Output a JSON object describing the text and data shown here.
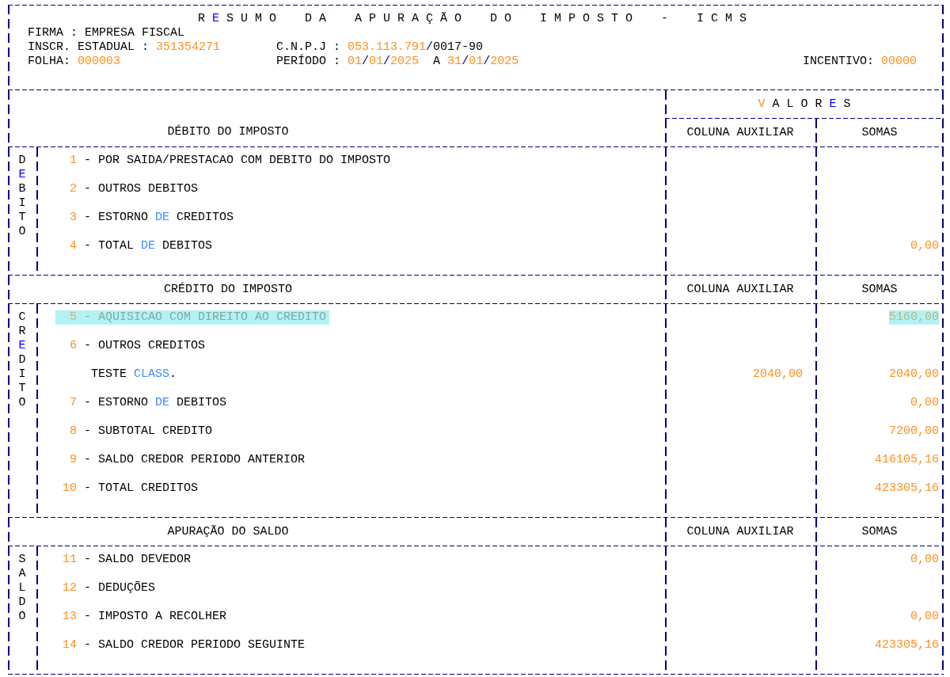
{
  "header": {
    "title": [
      {
        "text": "R"
      },
      {
        "text": "E",
        "color": "#0000ff"
      },
      {
        "text": "SUMO DA APURAÇÃO DO IMPOSTO - ICMS"
      }
    ],
    "firma": {
      "label": "FIRMA :",
      "value": "EMPRESA FISCAL"
    },
    "inscricao": {
      "label": "INSCR. ESTADUAL :",
      "value": "351354271"
    },
    "cnpj": {
      "label": "C.N.P.J :",
      "root": "053.113.791",
      "branch": "/0017-90"
    },
    "folha": {
      "label": "FOLHA:",
      "value": "000003"
    },
    "periodo": {
      "label": "PERÍODO :",
      "start": "01/01/2025",
      "joiner": "A",
      "end": "31/01/2025"
    },
    "incentivo": {
      "label": "INCENTIVO:",
      "value": "00000"
    }
  },
  "values_heading": [
    {
      "text": "V",
      "color": "#ff9020"
    },
    {
      "text": "ALOR"
    },
    {
      "text": "E",
      "color": "#0000ff"
    },
    {
      "text": "S"
    }
  ],
  "sections": [
    {
      "heading": "DÉBITO DO IMPOSTO",
      "aux_heading": "COLUNA AUXILIAR",
      "sum_heading": "SOMAS",
      "side_letters": [
        {
          "char": "D"
        },
        {
          "char": "E",
          "color": "#0000ff"
        },
        {
          "char": "B"
        },
        {
          "char": "I"
        },
        {
          "char": "T"
        },
        {
          "char": "O"
        }
      ],
      "items": [
        {
          "kind": "line",
          "number": "1",
          "label": [
            {
              "text": "- POR SAIDA/PRESTACAO COM DEBITO DO IMPOSTO",
              "kind": "plain"
            }
          ],
          "selected": false
        },
        {
          "kind": "line",
          "number": "2",
          "label": [
            {
              "text": "- OUTROS DEBITOS",
              "kind": "plain"
            }
          ],
          "selected": false
        },
        {
          "kind": "line",
          "number": "3",
          "label": [
            {
              "text": "- ESTORNO ",
              "kind": "plain"
            },
            {
              "text": "DE",
              "kind": "keyword"
            },
            {
              "text": " CREDITOS",
              "kind": "plain"
            }
          ],
          "selected": false
        },
        {
          "kind": "line",
          "number": "4",
          "label": [
            {
              "text": "- TOTAL ",
              "kind": "plain"
            },
            {
              "text": "DE",
              "kind": "keyword"
            },
            {
              "text": " DEBITOS",
              "kind": "plain"
            }
          ],
          "sum": "0,00",
          "selected": false
        }
      ]
    },
    {
      "heading": "CRÉDITO DO IMPOSTO",
      "aux_heading": "COLUNA AUXILIAR",
      "sum_heading": "SOMAS",
      "side_letters": [
        {
          "char": "C"
        },
        {
          "char": "R"
        },
        {
          "char": "E",
          "color": "#0000ff"
        },
        {
          "char": "D"
        },
        {
          "char": "I"
        },
        {
          "char": "T"
        },
        {
          "char": "O"
        }
      ],
      "items": [
        {
          "kind": "line",
          "number": "5",
          "label": [
            {
              "text": "- AQUISICAO COM DIREITO AO CREDITO",
              "kind": "plain"
            }
          ],
          "sum": "5160,00",
          "selected": true
        },
        {
          "kind": "line",
          "number": "6",
          "label": [
            {
              "text": "- OUTROS CREDITOS",
              "kind": "plain"
            }
          ],
          "selected": false
        },
        {
          "kind": "detail",
          "label": [
            {
              "text": "TESTE ",
              "kind": "plain"
            },
            {
              "text": "CLASS",
              "kind": "keyword"
            },
            {
              "text": ".",
              "kind": "plain"
            }
          ],
          "aux": "2040,00",
          "sum": "2040,00",
          "selected": false
        },
        {
          "kind": "line",
          "number": "7",
          "label": [
            {
              "text": "- ESTORNO ",
              "kind": "plain"
            },
            {
              "text": "DE",
              "kind": "keyword"
            },
            {
              "text": " DEBITOS",
              "kind": "plain"
            }
          ],
          "sum": "0,00",
          "selected": false
        },
        {
          "kind": "line",
          "number": "8",
          "label": [
            {
              "text": "- SUBTOTAL CREDITO",
              "kind": "plain"
            }
          ],
          "sum": "7200,00",
          "selected": false
        },
        {
          "kind": "line",
          "number": "9",
          "label": [
            {
              "text": "- SALDO CREDOR PERIODO ANTERIOR",
              "kind": "plain"
            }
          ],
          "sum": "416105,16",
          "selected": false
        },
        {
          "kind": "line",
          "number": "10",
          "label": [
            {
              "text": "- TOTAL CREDITOS",
              "kind": "plain"
            }
          ],
          "sum": "423305,16",
          "selected": false
        }
      ]
    },
    {
      "heading": "APURAÇÃO DO SALDO",
      "aux_heading": "COLUNA AUXILIAR",
      "sum_heading": "SOMAS",
      "side_letters": [
        {
          "char": "S"
        },
        {
          "char": "A"
        },
        {
          "char": "L"
        },
        {
          "char": "D"
        },
        {
          "char": "O"
        }
      ],
      "items": [
        {
          "kind": "line",
          "number": "11",
          "label": [
            {
              "text": "- SALDO DEVEDOR",
              "kind": "plain"
            }
          ],
          "sum": "0,00",
          "selected": false
        },
        {
          "kind": "line",
          "number": "12",
          "label": [
            {
              "text": "- DEDUÇÕES",
              "kind": "plain"
            }
          ],
          "selected": false
        },
        {
          "kind": "line",
          "number": "13",
          "label": [
            {
              "text": "- IMPOSTO A RECOLHER",
              "kind": "plain"
            }
          ],
          "sum": "0,00",
          "selected": false
        },
        {
          "kind": "line",
          "number": "14",
          "label": [
            {
              "text": "- SALDO CREDOR PERIODO SEGUINTE",
              "kind": "plain"
            }
          ],
          "sum": "423305,16",
          "selected": false
        }
      ]
    }
  ]
}
